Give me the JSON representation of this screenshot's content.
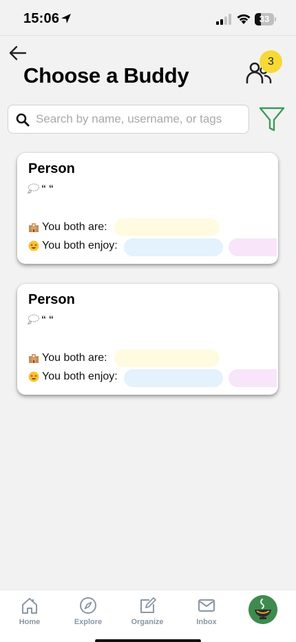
{
  "status_bar": {
    "time": "15:06",
    "battery": "33",
    "battery_fraction": 0.33
  },
  "header": {
    "title": "Choose a Buddy",
    "badge_count": "3"
  },
  "search": {
    "placeholder": "Search by name, username, or tags",
    "value": ""
  },
  "cards": [
    {
      "name": "Person",
      "quote": "“ “",
      "both_are_label": "You both are:",
      "both_enjoy_label": "You both enjoy:"
    },
    {
      "name": "Person",
      "quote": "“ “",
      "both_are_label": "You both are:",
      "both_enjoy_label": "You both enjoy:"
    }
  ],
  "tab_bar": {
    "items": [
      {
        "label": "Home",
        "icon": "home-icon"
      },
      {
        "label": "Explore",
        "icon": "compass-icon"
      },
      {
        "label": "Organize",
        "icon": "edit-icon"
      },
      {
        "label": "Inbox",
        "icon": "mail-icon"
      }
    ],
    "profile_icon": "tea-bowl-avatar"
  },
  "colors": {
    "accent_green": "#3f9a57",
    "badge_yellow": "#f6d937",
    "tab_gray": "#8a96a3",
    "pill_yellow": "#fffbe1",
    "pill_blue": "#e3f2fc",
    "pill_pink": "#f8e5f9"
  }
}
